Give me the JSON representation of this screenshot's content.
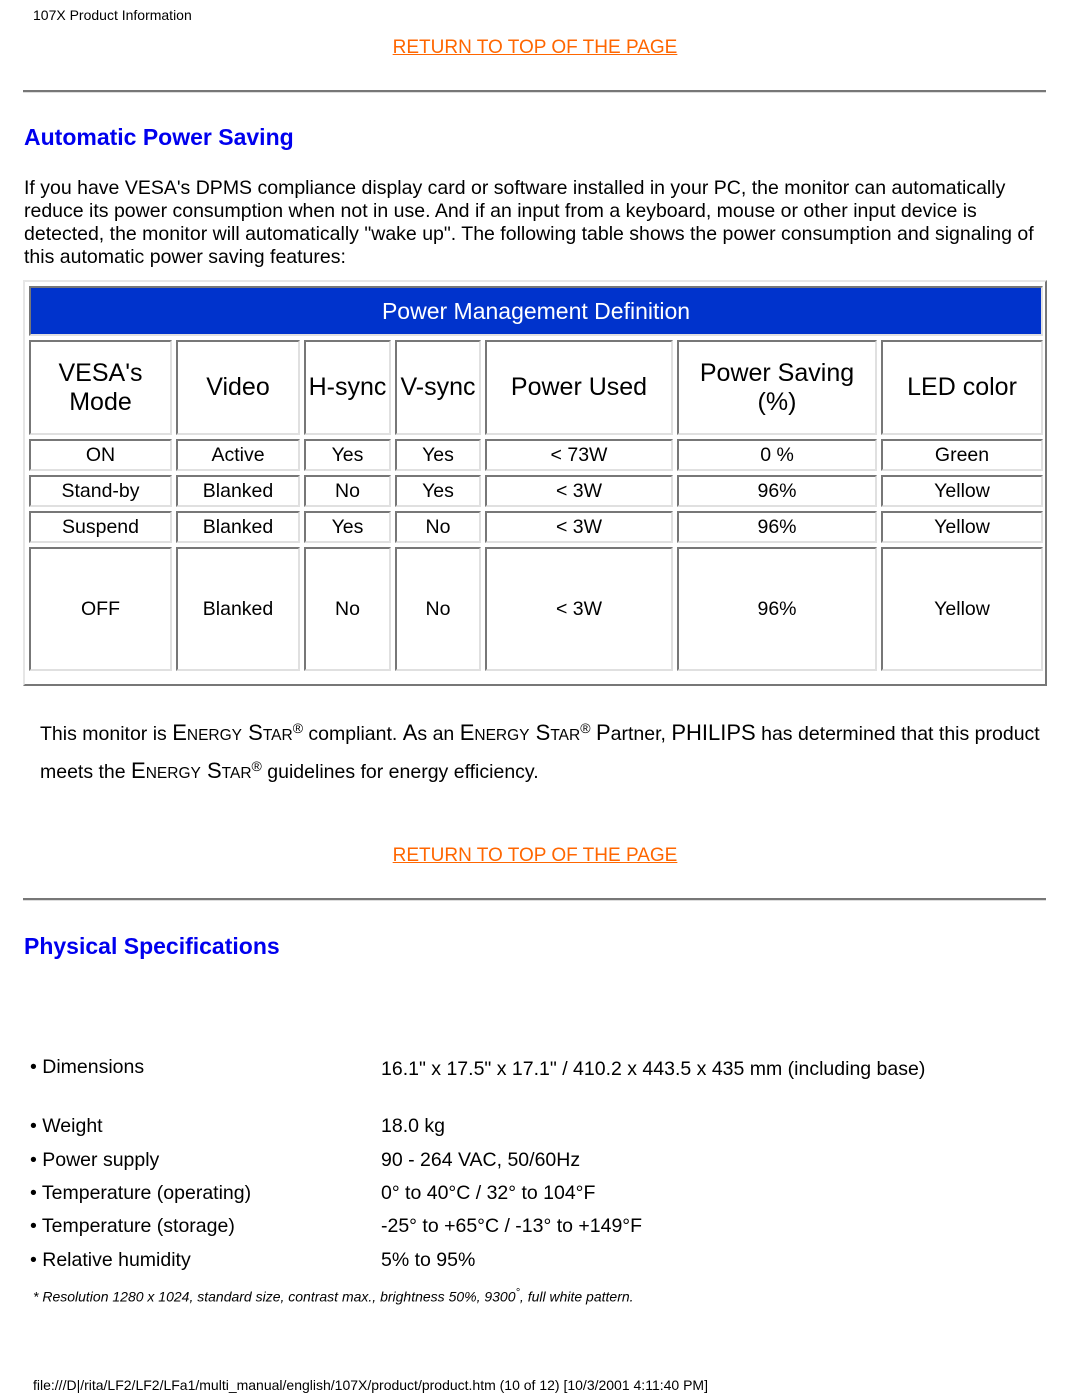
{
  "page_header": "107X Product Information",
  "return_link": "RETURN TO TOP OF THE PAGE",
  "colors": {
    "link": "#ff6600",
    "heading": "#0000ee",
    "table_title_bg": "#0033cc",
    "table_title_text": "#ffffff"
  },
  "automatic_power_saving": {
    "title": "Automatic Power Saving",
    "intro": "If you have VESA's DPMS compliance display card or software installed in your PC, the monitor can automatically reduce its power consumption when not in use. And if an input from a keyboard, mouse or other input device is detected, the monitor will automatically \"wake up\". The following table shows the power consumption and signaling of this automatic power saving features:",
    "table": {
      "title": "Power Management Definition",
      "headers": [
        "VESA's Mode",
        "Video",
        "H-sync",
        "V-sync",
        "Power Used",
        "Power Saving (%)",
        "LED color"
      ],
      "header_lines": {
        "vesa_line1": "VESA's",
        "vesa_line2": "Mode",
        "saving_line1": "Power Saving",
        "saving_line2": "(%)"
      },
      "rows": [
        [
          "ON",
          "Active",
          "Yes",
          "Yes",
          "< 73W",
          "0 %",
          "Green"
        ],
        [
          "Stand-by",
          "Blanked",
          "No",
          "Yes",
          "< 3W",
          "96%",
          "Yellow"
        ],
        [
          "Suspend",
          "Blanked",
          "Yes",
          "No",
          "< 3W",
          "96%",
          "Yellow"
        ],
        [
          "OFF",
          "Blanked",
          "No",
          "No",
          "< 3W",
          "96%",
          "Yellow"
        ]
      ]
    },
    "energy_star": {
      "t1": "This monitor is ",
      "E": "E",
      "NERGY": "NERGY",
      "S": "S",
      "TAR": "TAR",
      "reg": "®",
      "t2": " compliant. ",
      "A": "A",
      "s_an": "s an ",
      "t3": " ",
      "P": "P",
      "artner": "artner, ",
      "philips": "PHILIPS",
      "t4": " has determined that this product meets the ",
      "t5": " guidelines for energy efficiency."
    }
  },
  "physical_specifications": {
    "title": "Physical Specifications",
    "bullet": "•",
    "items": [
      {
        "label": "Dimensions",
        "value": "16.1\" x 17.5\" x 17.1\" / 410.2 x 443.5 x 435 mm (including base)"
      },
      {
        "label": "Weight",
        "value": "18.0 kg"
      },
      {
        "label": "Power supply",
        "value": "90 - 264 VAC, 50/60Hz"
      },
      {
        "label": "Temperature (operating)",
        "value": "0° to 40°C / 32° to 104°F"
      },
      {
        "label": "Temperature (storage)",
        "value": "-25° to +65°C / -13° to +149°F"
      },
      {
        "label": "Relative humidity",
        "value": "5% to 95%"
      }
    ],
    "footnote_pre": "* Resolution 1280 x 1024, standard size, contrast max., brightness 50%, 9300",
    "footnote_sup": "°",
    "footnote_post": ", full white pattern."
  },
  "page_footer": "file:///D|/rita/LF2/LF2/LFa1/multi_manual/english/107X/product/product.htm (10 of 12) [10/3/2001 4:11:40 PM]"
}
